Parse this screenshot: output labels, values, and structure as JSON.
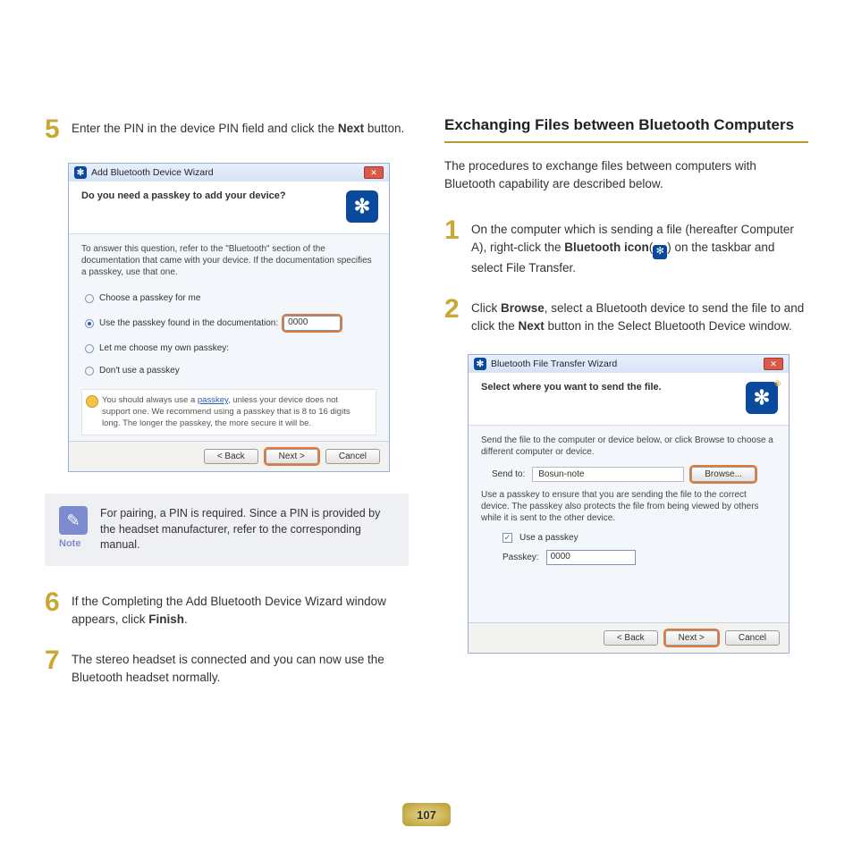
{
  "page_number": "107",
  "left": {
    "step5": {
      "num": "5",
      "text_a": "Enter the PIN in the device PIN field and click the ",
      "text_b": "Next",
      "text_c": " button."
    },
    "dialog1": {
      "title": "Add Bluetooth Device Wizard",
      "question": "Do you need a passkey to add your device?",
      "info": "To answer this question, refer to the \"Bluetooth\" section of the documentation that came with your device. If the documentation specifies a passkey, use that one.",
      "opt1": "Choose a passkey for me",
      "opt2": "Use the passkey found in the documentation:",
      "passkey": "0000",
      "opt3": "Let me choose my own passkey:",
      "opt4": "Don't use a passkey",
      "warn_a": "You should always use a ",
      "warn_link": "passkey",
      "warn_b": ", unless your device does not support one. We recommend using a passkey that is 8 to 16 digits long. The longer the passkey, the more secure it will be.",
      "btn_back": "< Back",
      "btn_next": "Next >",
      "btn_cancel": "Cancel"
    },
    "note": {
      "label": "Note",
      "text": "For pairing, a PIN is required. Since a PIN is provided by the headset manufacturer, refer to the corresponding manual."
    },
    "step6": {
      "num": "6",
      "text_a": "If the Completing the Add Bluetooth Device Wizard window appears, click ",
      "text_b": "Finish",
      "text_c": "."
    },
    "step7": {
      "num": "7",
      "text": "The stereo headset is connected and you can now use the Bluetooth headset normally."
    }
  },
  "right": {
    "heading": "Exchanging Files between Bluetooth Computers",
    "intro": "The procedures to exchange files between computers with Bluetooth capability are described below.",
    "step1": {
      "num": "1",
      "text_a": "On the computer which is sending a file (hereafter Computer A), right-click the ",
      "text_b": "Bluetooth icon",
      "text_c": "(",
      "text_d": ") on the taskbar and select File Transfer."
    },
    "step2": {
      "num": "2",
      "text_a": "Click ",
      "text_b": "Browse",
      "text_c": ", select a Bluetooth device to send the file to and click the ",
      "text_d": "Next",
      "text_e": " button in the Select Bluetooth Device window."
    },
    "dialog2": {
      "title": "Bluetooth File Transfer Wizard",
      "question": "Select where you want to send the file.",
      "info1": "Send the file to the computer or device below, or click Browse to choose a different computer or device.",
      "sendto_label": "Send to:",
      "sendto_value": "Bosun-note",
      "browse": "Browse...",
      "info2": "Use a passkey to ensure that you are sending the file to the correct device. The passkey also protects the file from being viewed by others while it is sent to the other device.",
      "use_passkey": "Use a passkey",
      "passkey_label": "Passkey:",
      "passkey_value": "0000",
      "btn_back": "< Back",
      "btn_next": "Next >",
      "btn_cancel": "Cancel"
    }
  }
}
